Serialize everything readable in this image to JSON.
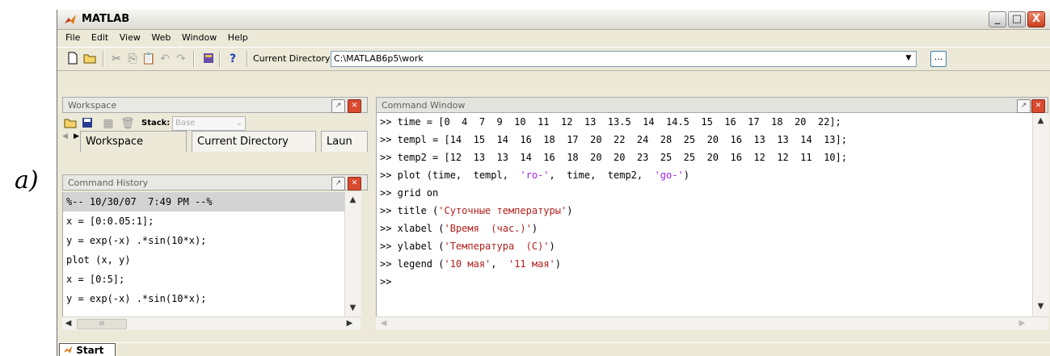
{
  "figure_label": "a)",
  "window": {
    "title": "MATLAB",
    "minimize": "_",
    "maximize": "□",
    "close": "X"
  },
  "menu": [
    "File",
    "Edit",
    "View",
    "Web",
    "Window",
    "Help"
  ],
  "toolbar": {
    "current_directory_label": "Current Directory:",
    "current_directory_value": "C:\\MATLAB6p5\\work",
    "browse_label": "..."
  },
  "workspace_panel": {
    "title": "Workspace",
    "stack_label": "Stack:",
    "stack_value": "Base",
    "tabs": [
      "Workspace",
      "Current Directory",
      "Laun"
    ]
  },
  "history_panel": {
    "title": "Command History",
    "items": [
      "%-- 10/30/07  7:49 PM --%",
      "x = [0:0.05:1];",
      "y = exp(-x) .*sin(10*x);",
      "plot (x, y)",
      "x = [0:5];",
      "y = exp(-x) .*sin(10*x);"
    ],
    "scroll_mark": "III"
  },
  "command_window": {
    "title": "Command Window",
    "prompt": ">>",
    "lines": [
      [
        {
          "t": " time = [0  4  7  9  10  11  12  13  13.5  14  14.5  15  16  17  18  20  22];"
        }
      ],
      [
        {
          "t": " templ = [14  15  14  16  18  17  20  22  24  28  25  20  16  13  13  14  13];"
        }
      ],
      [
        {
          "t": " temp2 = [12  13  13  14  16  18  20  20  23  25  25  20  16  12  12  11  10];"
        }
      ],
      [
        {
          "t": " plot (time,  templ,  "
        },
        {
          "t": "'ro-'",
          "s": "str"
        },
        {
          "t": ",  time,  temp2,  "
        },
        {
          "t": "'go-'",
          "s": "str"
        },
        {
          "t": ")"
        }
      ],
      [
        {
          "t": " grid on"
        }
      ],
      [
        {
          "t": " title ("
        },
        {
          "t": "'Суточные температуры'",
          "s": "str red"
        },
        {
          "t": ")"
        }
      ],
      [
        {
          "t": " xlabel ("
        },
        {
          "t": "'Время  (час.)'",
          "s": "str red"
        },
        {
          "t": ")"
        }
      ],
      [
        {
          "t": " ylabel ("
        },
        {
          "t": "'Температура  (С)'",
          "s": "str red"
        },
        {
          "t": ")"
        }
      ],
      [
        {
          "t": " legend ("
        },
        {
          "t": "'10 мая'",
          "s": "str red"
        },
        {
          "t": ",  "
        },
        {
          "t": "'11 мая'",
          "s": "str red"
        },
        {
          "t": ")"
        }
      ],
      []
    ]
  },
  "statusbar": {
    "start_label": "Start"
  },
  "colors": {
    "accent_orange": "#f08a24",
    "string_color": "#a020f0",
    "close_red": "#d94a2f"
  }
}
